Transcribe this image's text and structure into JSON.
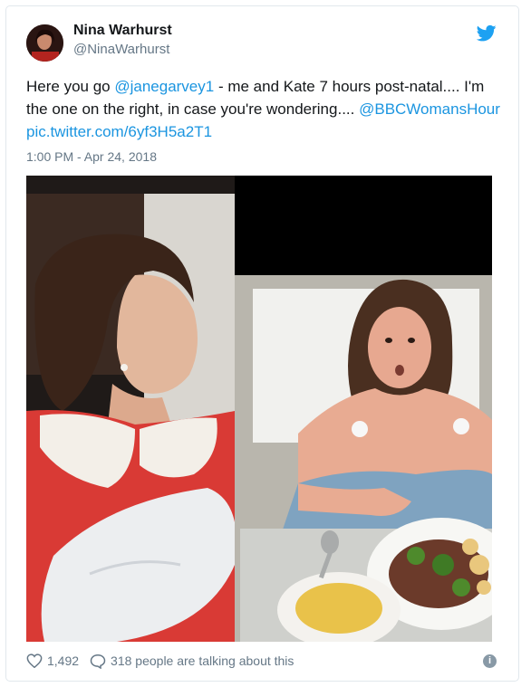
{
  "author": {
    "name": "Nina Warhurst",
    "handle": "@NinaWarhurst"
  },
  "tweet": {
    "text_1": "Here you go ",
    "mention_1": "@janegarvey1",
    "text_2": " - me and Kate 7 hours post-natal.... I'm the one on the right, in case you're wondering.... ",
    "mention_2": "@BBCWomansHour",
    "text_3": " ",
    "pic_link": "pic.twitter.com/6yf3H5a2T1",
    "timestamp": "1:00 PM - Apr 24, 2018"
  },
  "footer": {
    "likes": "1,492",
    "talking": "318 people are talking about this"
  },
  "colors": {
    "link": "#1b95e0",
    "secondary": "#657786",
    "twitter_blue": "#1da1f2"
  },
  "icons": [
    "twitter-bird-icon",
    "heart-icon",
    "speech-bubble-icon",
    "info-icon"
  ]
}
